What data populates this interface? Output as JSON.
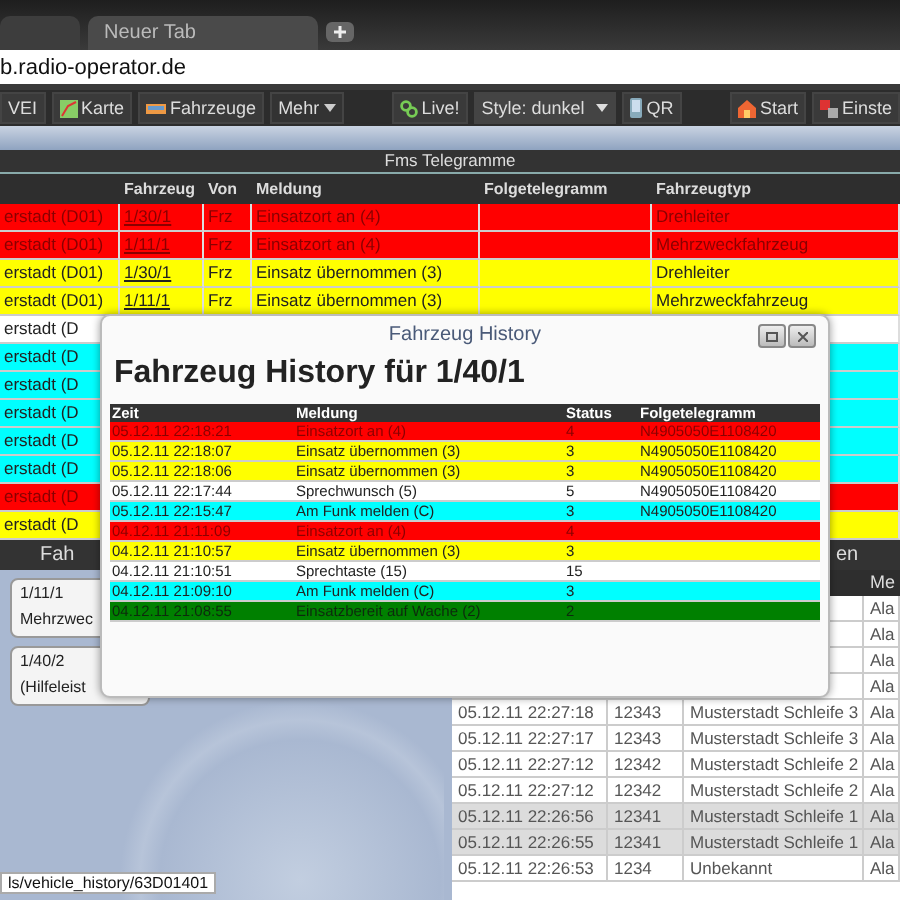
{
  "browser": {
    "tabs": [
      {
        "selected": false
      },
      {
        "label": "Neuer Tab",
        "selected": true
      }
    ],
    "address": "b.radio-operator.de"
  },
  "toolbar": {
    "left": [
      {
        "kind": "button",
        "label": "VEI"
      },
      {
        "kind": "button",
        "label": "Karte"
      },
      {
        "kind": "button",
        "label": "Fahrzeuge"
      },
      {
        "kind": "menu",
        "label": "Mehr"
      }
    ],
    "center": [
      {
        "kind": "button",
        "label": "Live!"
      },
      {
        "kind": "select",
        "label": "Style: dunkel"
      },
      {
        "kind": "button",
        "label": "QR"
      }
    ],
    "right": [
      {
        "kind": "button",
        "label": "Start"
      },
      {
        "kind": "button",
        "label": "Einste"
      }
    ]
  },
  "fms": {
    "title": "Fms Telegramme",
    "columns": [
      "",
      "Fahrzeug",
      "Von",
      "Meldung",
      "Folgetelegramm",
      "Fahrzeugtyp"
    ],
    "rows": [
      {
        "color": "#ff0000",
        "cells": [
          "erstadt (D01)",
          "1/30/1",
          "Frz",
          "Einsatzort an (4)",
          "",
          "Drehleiter"
        ]
      },
      {
        "color": "#ff0000",
        "cells": [
          "erstadt (D01)",
          "1/11/1",
          "Frz",
          "Einsatzort an (4)",
          "",
          "Mehrzweckfahrzeug"
        ]
      },
      {
        "color": "#ffff00",
        "cells": [
          "erstadt (D01)",
          "1/30/1",
          "Frz",
          "Einsatz übernommen (3)",
          "",
          "Drehleiter"
        ]
      },
      {
        "color": "#ffff00",
        "cells": [
          "erstadt (D01)",
          "1/11/1",
          "Frz",
          "Einsatz übernommen (3)",
          "",
          "Mehrzweckfahrzeug"
        ]
      },
      {
        "color": "#ffffff",
        "cells": [
          "erstadt (D"
        ]
      },
      {
        "color": "#00ffff",
        "cells": [
          "erstadt (D"
        ]
      },
      {
        "color": "#00ffff",
        "cells": [
          "erstadt (D"
        ]
      },
      {
        "color": "#00ffff",
        "cells": [
          "erstadt (D"
        ]
      },
      {
        "color": "#00ffff",
        "cells": [
          "erstadt (D"
        ]
      },
      {
        "color": "#00ffff",
        "cells": [
          "erstadt (D"
        ]
      },
      {
        "color": "#ff0000",
        "cells": [
          "erstadt (D"
        ]
      },
      {
        "color": "#ffff00",
        "cells": [
          "erstadt (D"
        ]
      }
    ]
  },
  "vehicles": {
    "title": "Fah",
    "cards": [
      {
        "lines": [
          "1/11/1",
          "Mehrzwec"
        ]
      },
      {
        "lines": [
          "1/40/2",
          "(Hilfeleist"
        ]
      }
    ]
  },
  "alarms": {
    "title": "en",
    "columns": [
      "",
      "",
      "",
      "Me"
    ],
    "rows": [
      {
        "shaded": false,
        "cells": [
          "",
          "",
          "",
          "Ala"
        ]
      },
      {
        "shaded": false,
        "cells": [
          "",
          "",
          "",
          "Ala"
        ]
      },
      {
        "shaded": false,
        "cells": [
          "",
          "",
          "",
          "Ala"
        ]
      },
      {
        "shaded": false,
        "cells": [
          "",
          "",
          "",
          "Ala"
        ]
      },
      {
        "shaded": false,
        "cells": [
          "05.12.11 22:27:18",
          "12343",
          "Musterstadt Schleife 3",
          "Ala"
        ]
      },
      {
        "shaded": false,
        "cells": [
          "05.12.11 22:27:17",
          "12343",
          "Musterstadt Schleife 3",
          "Ala"
        ]
      },
      {
        "shaded": false,
        "cells": [
          "05.12.11 22:27:12",
          "12342",
          "Musterstadt Schleife 2",
          "Ala"
        ]
      },
      {
        "shaded": false,
        "cells": [
          "05.12.11 22:27:12",
          "12342",
          "Musterstadt Schleife 2",
          "Ala"
        ]
      },
      {
        "shaded": true,
        "cells": [
          "05.12.11 22:26:56",
          "12341",
          "Musterstadt Schleife 1",
          "Ala"
        ]
      },
      {
        "shaded": true,
        "cells": [
          "05.12.11 22:26:55",
          "12341",
          "Musterstadt Schleife 1",
          "Ala"
        ]
      },
      {
        "shaded": false,
        "cells": [
          "05.12.11 22:26:53",
          "1234",
          "Unbekannt",
          "Ala"
        ]
      }
    ]
  },
  "dialog": {
    "title": "Fahrzeug History",
    "heading": "Fahrzeug History für 1/40/1",
    "columns": [
      "Zeit",
      "Meldung",
      "Status",
      "Folgetelegramm"
    ],
    "rows": [
      {
        "color": "#ff0000",
        "cells": [
          "05.12.11 22:18:21",
          "Einsatzort an (4)",
          "4",
          "N4905050E1108420"
        ]
      },
      {
        "color": "#ffff00",
        "cells": [
          "05.12.11 22:18:07",
          "Einsatz übernommen (3)",
          "3",
          "N4905050E1108420"
        ]
      },
      {
        "color": "#ffff00",
        "cells": [
          "05.12.11 22:18:06",
          "Einsatz übernommen (3)",
          "3",
          "N4905050E1108420"
        ]
      },
      {
        "color": "#ffffff",
        "cells": [
          "05.12.11 22:17:44",
          "Sprechwunsch (5)",
          "5",
          "N4905050E1108420"
        ]
      },
      {
        "color": "#00ffff",
        "cells": [
          "05.12.11 22:15:47",
          "Am Funk melden (C)",
          "3",
          "N4905050E1108420"
        ]
      },
      {
        "color": "#ff0000",
        "cells": [
          "04.12.11 21:11:09",
          "Einsatzort an (4)",
          "4",
          ""
        ]
      },
      {
        "color": "#ffff00",
        "cells": [
          "04.12.11 21:10:57",
          "Einsatz übernommen (3)",
          "3",
          ""
        ]
      },
      {
        "color": "#ffffff",
        "cells": [
          "04.12.11 21:10:51",
          "Sprechtaste (15)",
          "15",
          ""
        ]
      },
      {
        "color": "#00ffff",
        "cells": [
          "04.12.11 21:09:10",
          "Am Funk melden (C)",
          "3",
          ""
        ]
      },
      {
        "color": "#008000",
        "cells": [
          "04.12.11 21:08:55",
          "Einsatzbereit auf Wache (2)",
          "2",
          ""
        ]
      }
    ]
  },
  "status_url": "ls/vehicle_history/63D01401"
}
